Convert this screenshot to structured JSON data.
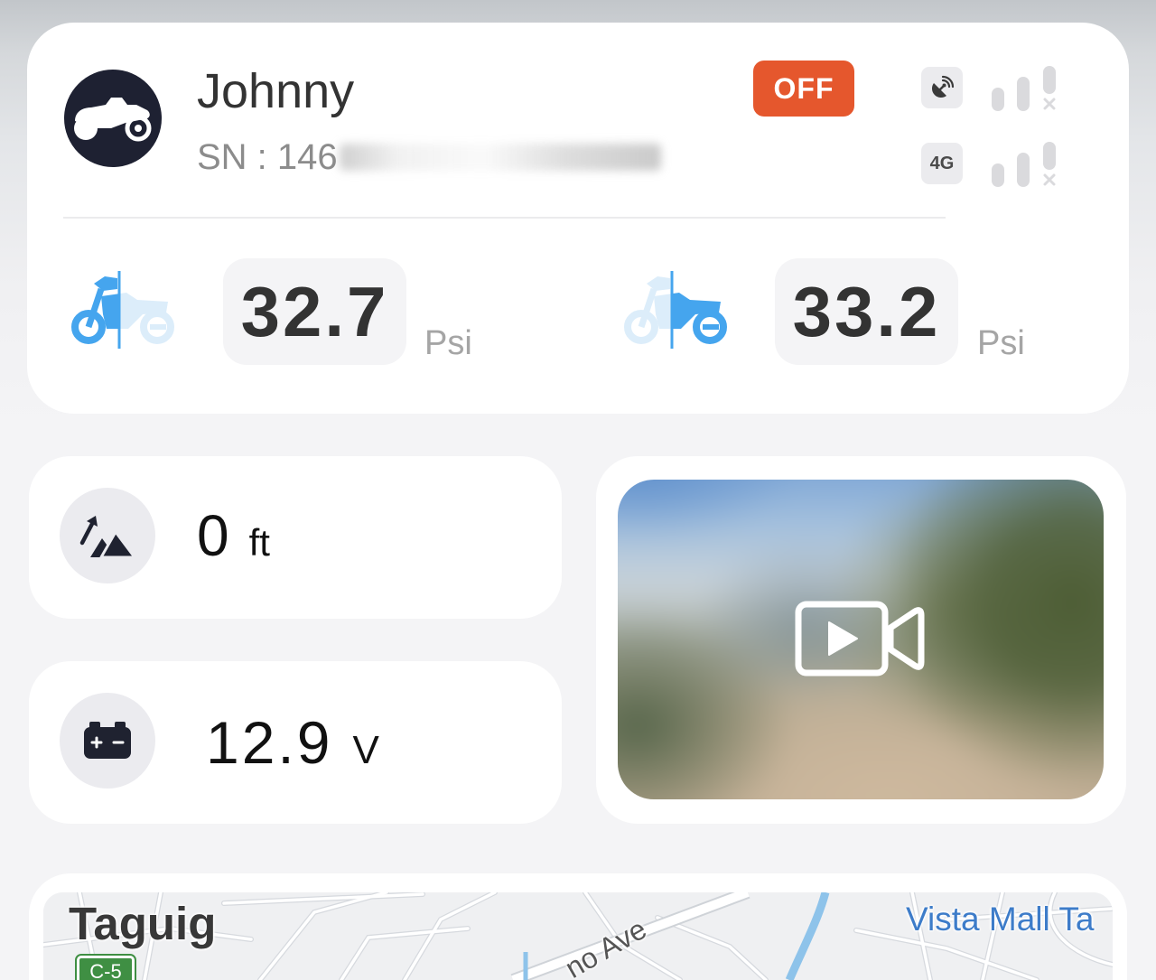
{
  "header": {
    "device_name": "Johnny",
    "serial_label": "SN : 146",
    "power_status": "OFF",
    "network_type": "4G",
    "avatar_icon": "motorcycle-icon",
    "gps_icon": "satellite-icon",
    "gps_signal_icon": "signal-bars-no-service-icon",
    "network_signal_icon": "signal-bars-no-service-icon"
  },
  "tire_pressure": {
    "front": {
      "value": "32.7",
      "unit": "Psi",
      "icon": "front-tire-icon"
    },
    "rear": {
      "value": "33.2",
      "unit": "Psi",
      "icon": "rear-tire-icon"
    }
  },
  "altitude": {
    "value": "0",
    "unit": "ft",
    "icon": "mountain-icon"
  },
  "battery": {
    "value": "12.9",
    "unit": "V",
    "icon": "battery-icon"
  },
  "video": {
    "icon": "video-play-icon"
  },
  "map": {
    "area_label": "Taguig",
    "poi_label": "Vista Mall Ta",
    "street_label": "no Ave",
    "route_shield": "C-5"
  },
  "colors": {
    "status_off": "#e5572d",
    "tire_highlight": "#45a5ee",
    "tire_muted": "#dcedfa",
    "avatar_bg": "#1e2132",
    "poi_text": "#3d7cc9",
    "route_shield": "#3f8f43",
    "river": "#8ec3ea"
  }
}
